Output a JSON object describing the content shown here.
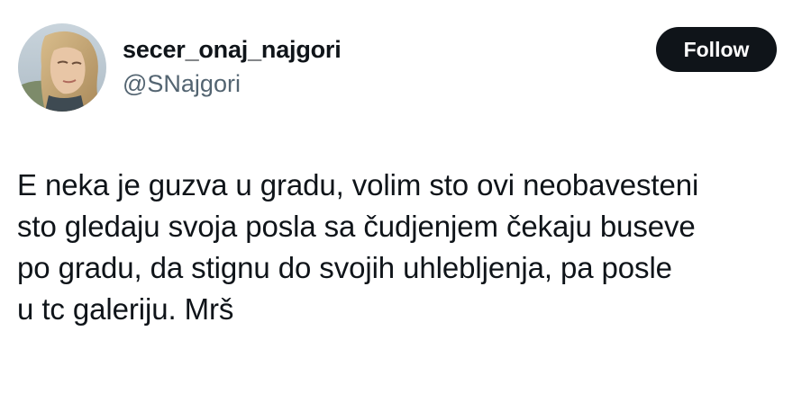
{
  "author": {
    "display_name": "secer_onaj_najgori",
    "handle": "@SNajgori",
    "avatar_icon": "profile-photo"
  },
  "follow_button": {
    "label": "Follow",
    "background": "#0f1419",
    "text_color": "#ffffff"
  },
  "tweet": {
    "text": "E neka je guzva u gradu, volim sto ovi neobavesteni\nsto gledaju svoja posla sa čudjenjem čekaju buseve\npo gradu, da stignu do svojih uhlebljenja, pa posle\nu tc galeriju. Mrš"
  },
  "colors": {
    "text_primary": "#0f1419",
    "text_secondary": "#536471",
    "background": "#ffffff"
  }
}
